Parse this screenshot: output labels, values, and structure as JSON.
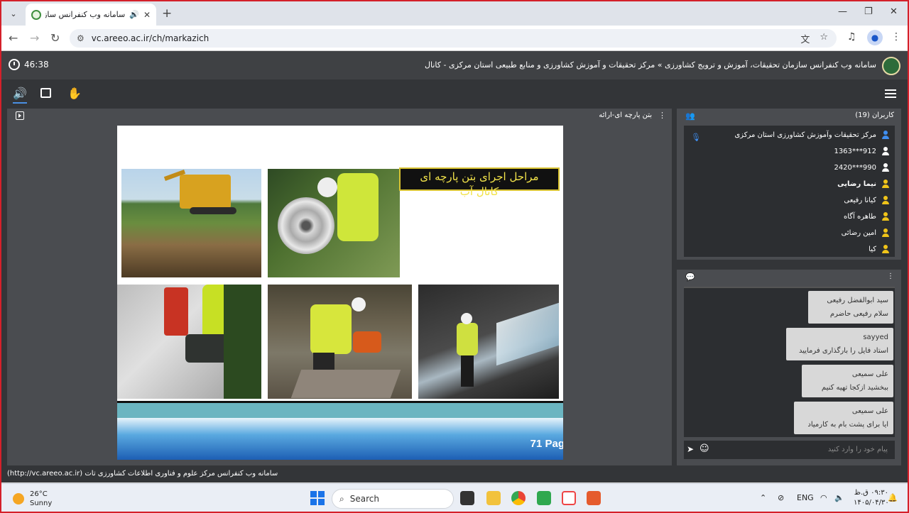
{
  "browser": {
    "tab_title": "سامانه وب کنفرانس سازمان تحقیقات",
    "url": "vc.areeo.ac.ir/ch/markazich"
  },
  "app": {
    "timer": "46:38",
    "title": "سامانه وب کنفرانس سازمان تحقیقات، آموزش و ترویج کشاورزی » مرکز تحقیقات و آموزش کشاورزی و منابع طبیعی استان مرکزی - کانال"
  },
  "presentation": {
    "title": "بتن پارچه ای-ارائه",
    "slide_caption": "مراحل اجرای بتن پارچه ای",
    "slide_caption_sub": "کانال آب",
    "page_label": "71 Pag"
  },
  "users": {
    "header": "کاربران (19)",
    "items": [
      {
        "name": "مرکز تحقیقات وآموزش کشاورزی استان مرکزی",
        "color": "#3f8ef0",
        "bold": false
      },
      {
        "name": "912***1363",
        "color": "#ffffff",
        "bold": false
      },
      {
        "name": "990***2420",
        "color": "#ffffff",
        "bold": false
      },
      {
        "name": "نیما رضایی",
        "color": "#f0c419",
        "bold": true
      },
      {
        "name": "کیانا رفیعی",
        "color": "#f0c419",
        "bold": false
      },
      {
        "name": "طاهره آگاه",
        "color": "#f0c419",
        "bold": false
      },
      {
        "name": "امین رضائی",
        "color": "#f0c419",
        "bold": false
      },
      {
        "name": "کیا",
        "color": "#f0c419",
        "bold": false
      }
    ]
  },
  "chat": {
    "messages": [
      {
        "sender": "سید ابوالفضل رفیعی",
        "text": "سلام رفیعی حاضرم"
      },
      {
        "sender": "sayyed",
        "text": "استاد فایل را بارگذاری فرمایید"
      },
      {
        "sender": "علی سمیعی",
        "text": "ببخشید ازکجا تهیه کنیم"
      },
      {
        "sender": "علی سمیعی",
        "text": "ایا برای پشت بام به کارمیاد"
      }
    ],
    "placeholder": "پیام خود را وارد کنید"
  },
  "footer": {
    "text": "سامانه وب کنفرانس مرکز علوم و فناوری اطلاعات کشاورزی تات (http://vc.areeo.ac.ir)"
  },
  "taskbar": {
    "temperature": "26°C",
    "weather": "Sunny",
    "search": "Search",
    "lang": "ENG",
    "time": "۰۹:۳۰ ق.ظ",
    "date": "۱۴۰۵/۰۴/۳۰"
  }
}
